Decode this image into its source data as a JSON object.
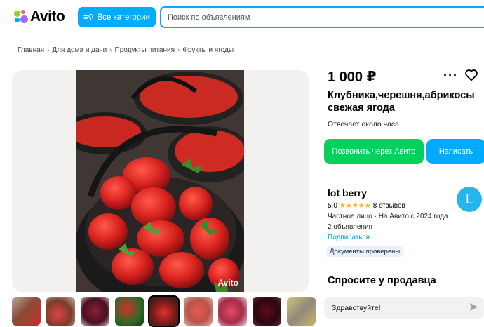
{
  "header": {
    "logo_text": "Avito",
    "categories_label": "Все категории",
    "search_placeholder": "Поиск по объявлениям"
  },
  "breadcrumb": [
    "Главная",
    "Для дома и дачи",
    "Продукты питания",
    "Фрукты и ягоды"
  ],
  "gallery": {
    "watermark": "Avito",
    "thumbnail_count": 9,
    "active_thumbnail": 5
  },
  "listing": {
    "price": "1 000 ₽",
    "title": "Клубника,черешня,абрикосы свежая ягода",
    "reply_time": "Отвечает около часа",
    "call_button": "Позвонить через Авито",
    "write_button": "Написать"
  },
  "seller": {
    "name": "lot berry",
    "rating": "5,0",
    "stars": "★★★★★",
    "reviews": "8 отзывов",
    "meta": "Частное лицо · На Авито с 2024 года",
    "ads": "2 объявления",
    "subscribe": "Подписаться",
    "verified_badge": "Документы проверены",
    "avatar_letter": "L"
  },
  "ask": {
    "title": "Спросите у продавца",
    "message": "Здравствуйте!"
  },
  "colors": {
    "accent_blue": "#00aaff",
    "call_green": "#02d15c",
    "star_yellow": "#ffb021",
    "link_blue": "#0099f7"
  },
  "icons": [
    "filter-icon",
    "more-icon",
    "heart-icon",
    "send-icon",
    "avito-logo-icon"
  ]
}
